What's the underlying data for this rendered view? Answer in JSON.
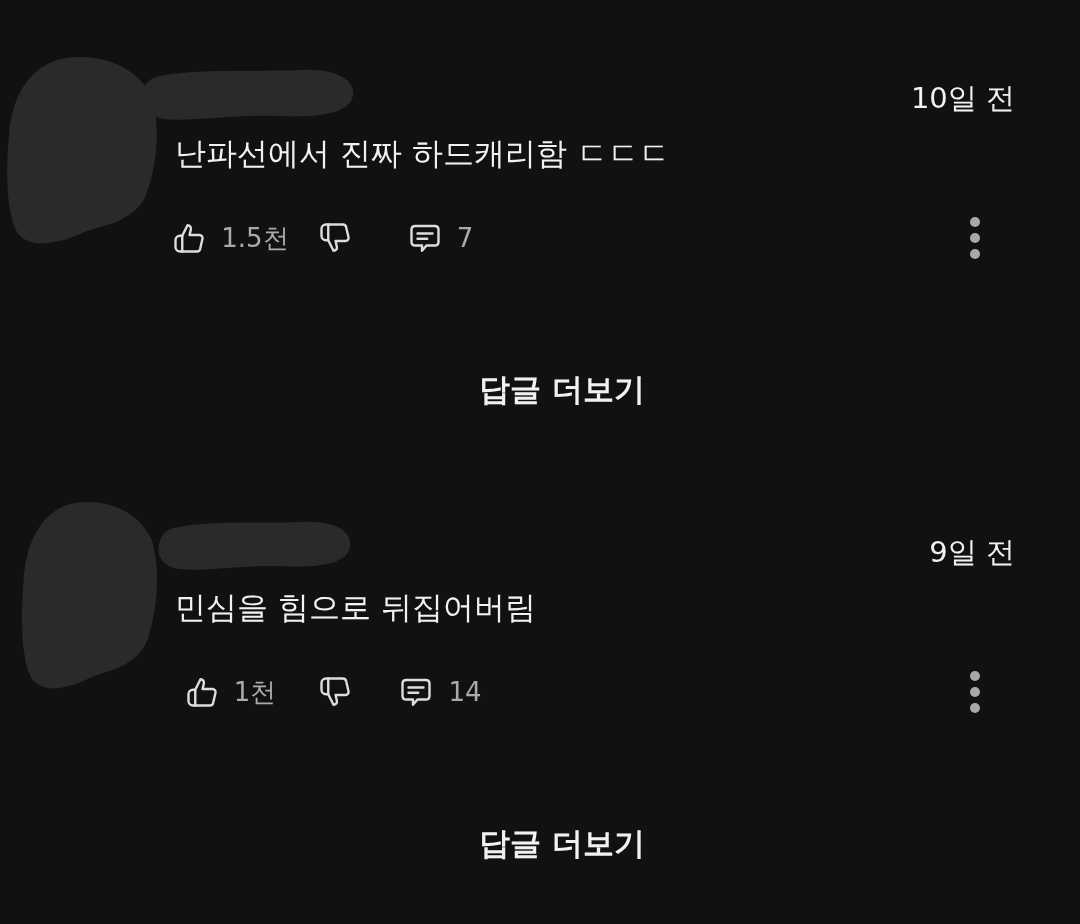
{
  "comments": [
    {
      "timestamp": "10일 전",
      "text": "난파선에서 진짜 하드캐리함 ㄷㄷㄷ",
      "likes": "1.5천",
      "replies": "7",
      "more_replies": "답글 더보기"
    },
    {
      "timestamp": "9일 전",
      "text": "민심을 힘으로 뒤집어버림",
      "likes": "1천",
      "replies": "14",
      "more_replies": "답글 더보기"
    }
  ]
}
